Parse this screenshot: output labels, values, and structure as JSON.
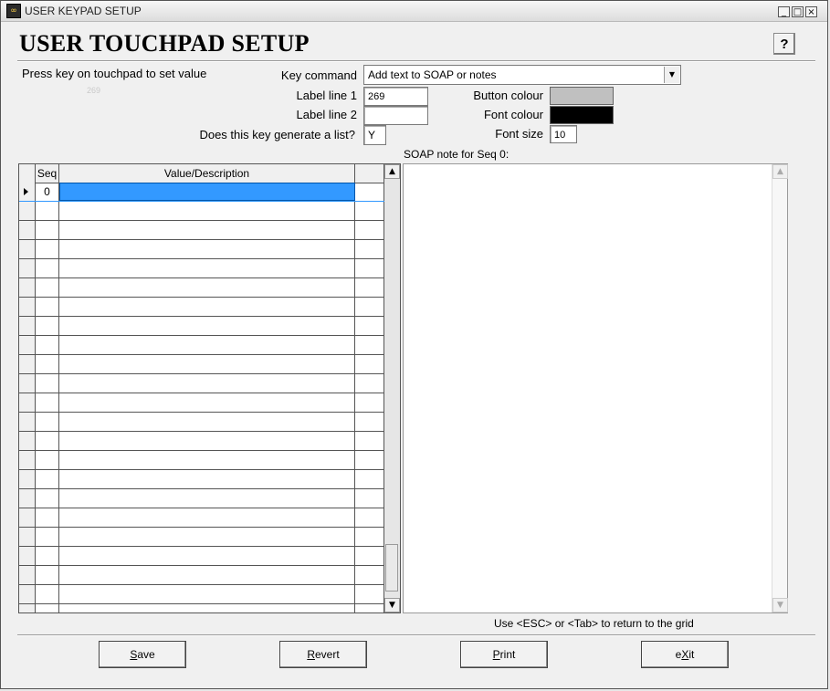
{
  "window": {
    "title": "USER KEYPAD SETUP",
    "icon_glyph": "∞",
    "controls": [
      "_",
      "□",
      "×"
    ]
  },
  "header": {
    "title": "USER TOUCHPAD SETUP",
    "help_label": "?"
  },
  "form": {
    "instruction": "Press key on touchpad to set value",
    "faint_text": "269",
    "key_command_label": "Key command",
    "key_command_value": "Add text to SOAP or notes",
    "label_line1_label": "Label line 1",
    "label_line1_value": "269",
    "label_line2_label": "Label line 2",
    "label_line2_value": "",
    "generate_list_label": "Does this key generate a list?",
    "generate_list_value": "Y",
    "button_colour_label": "Button colour",
    "button_colour_hex": "#c0c0c0",
    "font_colour_label": "Font colour",
    "font_colour_hex": "#000000",
    "font_size_label": "Font size",
    "font_size_value": "10"
  },
  "grid": {
    "columns": [
      "",
      "Seq",
      "Value/Description",
      ""
    ],
    "rows": [
      {
        "seq": "0",
        "value": "",
        "selected": true
      }
    ],
    "empty_rows": 22
  },
  "soap": {
    "label": "SOAP note for Seq 0:",
    "text": ""
  },
  "hint": "Use <ESC> or <Tab> to return to the grid",
  "buttons": {
    "save": {
      "pre": "",
      "key": "S",
      "post": "ave"
    },
    "revert": {
      "pre": "",
      "key": "R",
      "post": "evert"
    },
    "print": {
      "pre": "",
      "key": "P",
      "post": "rint"
    },
    "exit": {
      "pre": "e",
      "key": "X",
      "post": "it"
    }
  },
  "icons": {
    "dropdown": "chevron-down-icon",
    "scroll_up": "arrow-up-icon",
    "scroll_down": "arrow-down-icon",
    "row_pointer": "row-pointer-icon"
  },
  "glyphs": {
    "up": "▲",
    "down": "▼"
  }
}
